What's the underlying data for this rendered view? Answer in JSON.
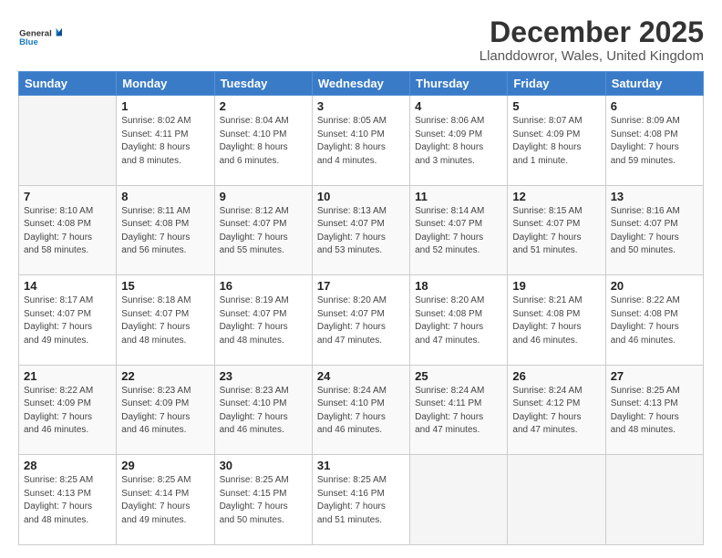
{
  "logo": {
    "line1": "General",
    "line2": "Blue"
  },
  "title": "December 2025",
  "location": "Llanddowror, Wales, United Kingdom",
  "days_of_week": [
    "Sunday",
    "Monday",
    "Tuesday",
    "Wednesday",
    "Thursday",
    "Friday",
    "Saturday"
  ],
  "weeks": [
    [
      {
        "num": "",
        "info": ""
      },
      {
        "num": "1",
        "info": "Sunrise: 8:02 AM\nSunset: 4:11 PM\nDaylight: 8 hours\nand 8 minutes."
      },
      {
        "num": "2",
        "info": "Sunrise: 8:04 AM\nSunset: 4:10 PM\nDaylight: 8 hours\nand 6 minutes."
      },
      {
        "num": "3",
        "info": "Sunrise: 8:05 AM\nSunset: 4:10 PM\nDaylight: 8 hours\nand 4 minutes."
      },
      {
        "num": "4",
        "info": "Sunrise: 8:06 AM\nSunset: 4:09 PM\nDaylight: 8 hours\nand 3 minutes."
      },
      {
        "num": "5",
        "info": "Sunrise: 8:07 AM\nSunset: 4:09 PM\nDaylight: 8 hours\nand 1 minute."
      },
      {
        "num": "6",
        "info": "Sunrise: 8:09 AM\nSunset: 4:08 PM\nDaylight: 7 hours\nand 59 minutes."
      }
    ],
    [
      {
        "num": "7",
        "info": "Sunrise: 8:10 AM\nSunset: 4:08 PM\nDaylight: 7 hours\nand 58 minutes."
      },
      {
        "num": "8",
        "info": "Sunrise: 8:11 AM\nSunset: 4:08 PM\nDaylight: 7 hours\nand 56 minutes."
      },
      {
        "num": "9",
        "info": "Sunrise: 8:12 AM\nSunset: 4:07 PM\nDaylight: 7 hours\nand 55 minutes."
      },
      {
        "num": "10",
        "info": "Sunrise: 8:13 AM\nSunset: 4:07 PM\nDaylight: 7 hours\nand 53 minutes."
      },
      {
        "num": "11",
        "info": "Sunrise: 8:14 AM\nSunset: 4:07 PM\nDaylight: 7 hours\nand 52 minutes."
      },
      {
        "num": "12",
        "info": "Sunrise: 8:15 AM\nSunset: 4:07 PM\nDaylight: 7 hours\nand 51 minutes."
      },
      {
        "num": "13",
        "info": "Sunrise: 8:16 AM\nSunset: 4:07 PM\nDaylight: 7 hours\nand 50 minutes."
      }
    ],
    [
      {
        "num": "14",
        "info": "Sunrise: 8:17 AM\nSunset: 4:07 PM\nDaylight: 7 hours\nand 49 minutes."
      },
      {
        "num": "15",
        "info": "Sunrise: 8:18 AM\nSunset: 4:07 PM\nDaylight: 7 hours\nand 48 minutes."
      },
      {
        "num": "16",
        "info": "Sunrise: 8:19 AM\nSunset: 4:07 PM\nDaylight: 7 hours\nand 48 minutes."
      },
      {
        "num": "17",
        "info": "Sunrise: 8:20 AM\nSunset: 4:07 PM\nDaylight: 7 hours\nand 47 minutes."
      },
      {
        "num": "18",
        "info": "Sunrise: 8:20 AM\nSunset: 4:08 PM\nDaylight: 7 hours\nand 47 minutes."
      },
      {
        "num": "19",
        "info": "Sunrise: 8:21 AM\nSunset: 4:08 PM\nDaylight: 7 hours\nand 46 minutes."
      },
      {
        "num": "20",
        "info": "Sunrise: 8:22 AM\nSunset: 4:08 PM\nDaylight: 7 hours\nand 46 minutes."
      }
    ],
    [
      {
        "num": "21",
        "info": "Sunrise: 8:22 AM\nSunset: 4:09 PM\nDaylight: 7 hours\nand 46 minutes."
      },
      {
        "num": "22",
        "info": "Sunrise: 8:23 AM\nSunset: 4:09 PM\nDaylight: 7 hours\nand 46 minutes."
      },
      {
        "num": "23",
        "info": "Sunrise: 8:23 AM\nSunset: 4:10 PM\nDaylight: 7 hours\nand 46 minutes."
      },
      {
        "num": "24",
        "info": "Sunrise: 8:24 AM\nSunset: 4:10 PM\nDaylight: 7 hours\nand 46 minutes."
      },
      {
        "num": "25",
        "info": "Sunrise: 8:24 AM\nSunset: 4:11 PM\nDaylight: 7 hours\nand 47 minutes."
      },
      {
        "num": "26",
        "info": "Sunrise: 8:24 AM\nSunset: 4:12 PM\nDaylight: 7 hours\nand 47 minutes."
      },
      {
        "num": "27",
        "info": "Sunrise: 8:25 AM\nSunset: 4:13 PM\nDaylight: 7 hours\nand 48 minutes."
      }
    ],
    [
      {
        "num": "28",
        "info": "Sunrise: 8:25 AM\nSunset: 4:13 PM\nDaylight: 7 hours\nand 48 minutes."
      },
      {
        "num": "29",
        "info": "Sunrise: 8:25 AM\nSunset: 4:14 PM\nDaylight: 7 hours\nand 49 minutes."
      },
      {
        "num": "30",
        "info": "Sunrise: 8:25 AM\nSunset: 4:15 PM\nDaylight: 7 hours\nand 50 minutes."
      },
      {
        "num": "31",
        "info": "Sunrise: 8:25 AM\nSunset: 4:16 PM\nDaylight: 7 hours\nand 51 minutes."
      },
      {
        "num": "",
        "info": ""
      },
      {
        "num": "",
        "info": ""
      },
      {
        "num": "",
        "info": ""
      }
    ]
  ]
}
